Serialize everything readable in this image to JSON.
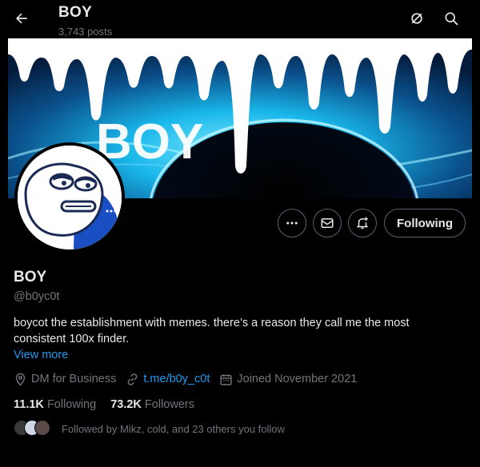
{
  "header": {
    "title": "BOY",
    "post_count": "3,743 posts"
  },
  "banner": {
    "text": "BOY"
  },
  "profile": {
    "name": "BOY",
    "handle": "@b0yc0t",
    "bio": "boycot the establishment with memes. there’s a reason they call me the most consistent 100x finder.",
    "view_more": "View more",
    "following_button": "Following"
  },
  "meta": {
    "business": "DM for Business",
    "link": "t.me/b0y_c0t",
    "joined": "Joined November 2021"
  },
  "stats": {
    "following_count": "11.1K",
    "following_label": "Following",
    "followers_count": "73.2K",
    "followers_label": "Followers"
  },
  "followed_by": "Followed by Mikz, cold, and 23 others you follow",
  "colors": {
    "background": "#000000",
    "text": "#e7e9ea",
    "muted": "#71767b",
    "link": "#1d9bf0",
    "border": "#536471"
  },
  "icons": [
    "back-arrow-icon",
    "grok-icon",
    "search-icon",
    "more-icon",
    "mail-icon",
    "bell-plus-icon",
    "location-icon",
    "link-icon",
    "calendar-icon"
  ]
}
